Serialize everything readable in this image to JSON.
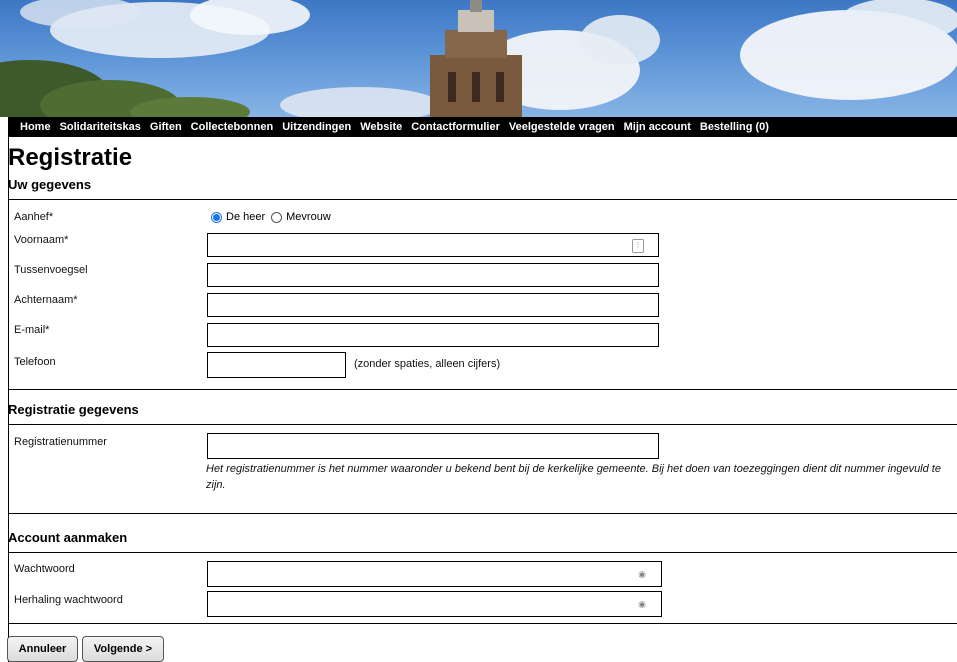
{
  "nav": {
    "items": [
      "Home",
      "Solidariteitskas",
      "Giften",
      "Collectebonnen",
      "Uitzendingen",
      "Website",
      "Contactformulier",
      "Veelgestelde vragen",
      "Mijn account",
      "Bestelling (0)"
    ]
  },
  "page": {
    "title": "Registratie"
  },
  "sections": {
    "personal": "Uw gegevens",
    "registration": "Registratie gegevens",
    "account": "Account aanmaken"
  },
  "form": {
    "salutation_label": "Aanhef*",
    "salutation_options": [
      "De heer",
      "Mevrouw"
    ],
    "salutation_selected": "De heer",
    "first_name_label": "Voornaam*",
    "infix_label": "Tussenvoegsel",
    "last_name_label": "Achternaam*",
    "email_label": "E-mail*",
    "phone_label": "Telefoon",
    "phone_hint": "(zonder spaties, alleen cijfers)",
    "regnr_label": "Registratienummer",
    "regnr_note": "Het registratienummer is het nummer waaronder u bekend bent bij de kerkelijke gemeente. Bij het doen van toezeggingen dient dit nummer ingevuld te zijn.",
    "password_label": "Wachtwoord",
    "password_repeat_label": "Herhaling wachtwoord",
    "values": {
      "first_name": "",
      "infix": "",
      "last_name": "",
      "email": "",
      "phone": "",
      "regnr": "",
      "password": "",
      "password_repeat": ""
    }
  },
  "buttons": {
    "cancel": "Annuleer",
    "next": "Volgende >"
  },
  "colors": {
    "nav_bg": "#000000",
    "radio_accent": "#1a73e8"
  }
}
